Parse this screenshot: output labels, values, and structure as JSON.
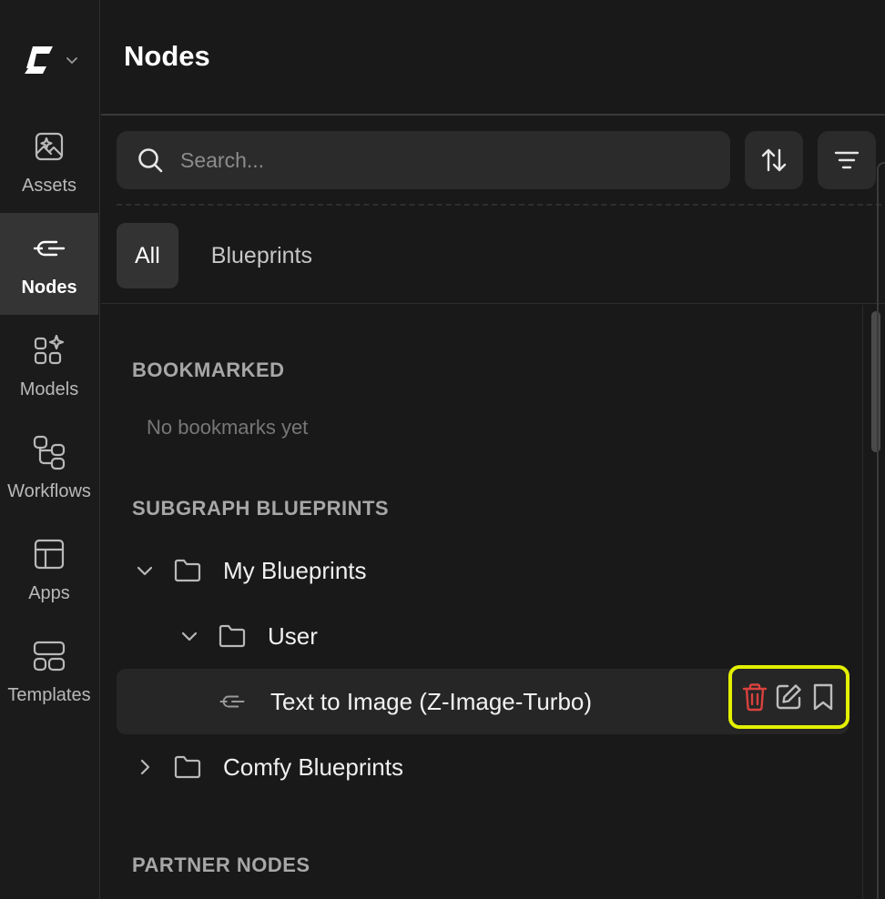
{
  "rail": {
    "items": [
      {
        "label": "Assets",
        "icon": "image-sparkle-icon",
        "active": false
      },
      {
        "label": "Nodes",
        "icon": "node-icon",
        "active": true
      },
      {
        "label": "Models",
        "icon": "models-grid-icon",
        "active": false
      },
      {
        "label": "Workflows",
        "icon": "workflow-icon",
        "active": false
      },
      {
        "label": "Apps",
        "icon": "layout-icon",
        "active": false
      },
      {
        "label": "Templates",
        "icon": "templates-icon",
        "active": false
      }
    ]
  },
  "header": {
    "title": "Nodes"
  },
  "search": {
    "placeholder": "Search..."
  },
  "tabs": [
    {
      "label": "All",
      "active": true
    },
    {
      "label": "Blueprints",
      "active": false
    }
  ],
  "sections": {
    "bookmarked": {
      "title": "BOOKMARKED",
      "empty": "No bookmarks yet"
    },
    "subgraph": {
      "title": "SUBGRAPH BLUEPRINTS"
    },
    "partner": {
      "title": "PARTNER NODES"
    }
  },
  "tree": {
    "my_blueprints": {
      "label": "My Blueprints",
      "expanded": true
    },
    "user": {
      "label": "User",
      "expanded": true
    },
    "node": {
      "label": "Text to Image (Z-Image-Turbo)"
    },
    "comfy_blueprints": {
      "label": "Comfy Blueprints",
      "expanded": false
    }
  },
  "colors": {
    "accent_highlight": "#e3f000",
    "delete": "#d9423e",
    "background": "#191919"
  }
}
